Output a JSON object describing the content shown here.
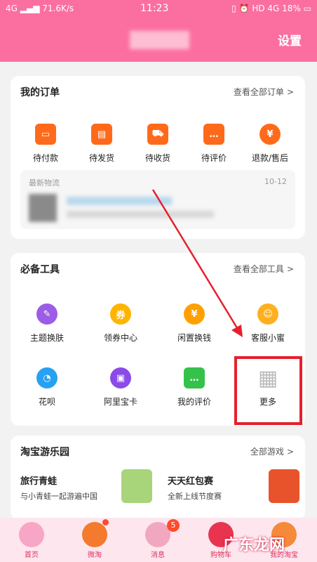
{
  "status_bar": {
    "network_left": "4G",
    "speed": "71.6K/s",
    "time": "11:23",
    "network_right": "HD 4G",
    "battery": "18%"
  },
  "header": {
    "settings_label": "设置"
  },
  "orders": {
    "title": "我的订单",
    "view_all": "查看全部订单",
    "items": [
      {
        "label": "待付款",
        "icon": "wallet-icon"
      },
      {
        "label": "待发货",
        "icon": "box-icon"
      },
      {
        "label": "待收货",
        "icon": "truck-icon"
      },
      {
        "label": "待评价",
        "icon": "comment-icon"
      },
      {
        "label": "退款/售后",
        "icon": "refund-icon"
      }
    ],
    "logistics": {
      "title": "最新物流",
      "date": "10-12"
    }
  },
  "tools": {
    "title": "必备工具",
    "view_all": "查看全部工具",
    "items": [
      {
        "label": "主题换肤",
        "icon": "palette-icon",
        "glyph": "✎",
        "color": "#9b5de5"
      },
      {
        "label": "领券中心",
        "icon": "coupon-icon",
        "glyph": "券",
        "color": "#ffb400"
      },
      {
        "label": "闲置换钱",
        "icon": "yuan-icon",
        "glyph": "¥",
        "color": "#ffa000"
      },
      {
        "label": "客服小蜜",
        "icon": "bee-icon",
        "glyph": "☺",
        "color": "#ffb020"
      },
      {
        "label": "花呗",
        "icon": "huabei-icon",
        "glyph": "◔",
        "color": "#27a1f2"
      },
      {
        "label": "阿里宝卡",
        "icon": "card-icon",
        "glyph": "▣",
        "color": "#8a4be8"
      },
      {
        "label": "我的评价",
        "icon": "message-icon",
        "glyph": "…",
        "color": "#35c24a"
      },
      {
        "label": "更多",
        "icon": "grid-icon",
        "glyph": "▦",
        "color": "#bbbbbb"
      }
    ]
  },
  "games": {
    "title": "淘宝游乐园",
    "view_all": "全部游戏",
    "items": [
      {
        "title": "旅行青蛙",
        "subtitle": "与小青蛙一起游遍中国"
      },
      {
        "title": "天天红包赛",
        "subtitle": "全新上线节度赛"
      }
    ]
  },
  "tabbar": {
    "items": [
      {
        "label": "首页",
        "icon": "bunny-icon"
      },
      {
        "label": "微淘",
        "icon": "carrot-icon"
      },
      {
        "label": "消息",
        "icon": "donut-icon",
        "badge": "5"
      },
      {
        "label": "购物车",
        "icon": "strawberry-icon"
      },
      {
        "label": "我的淘宝",
        "icon": "fox-icon"
      }
    ]
  },
  "watermark": "广东龙网"
}
